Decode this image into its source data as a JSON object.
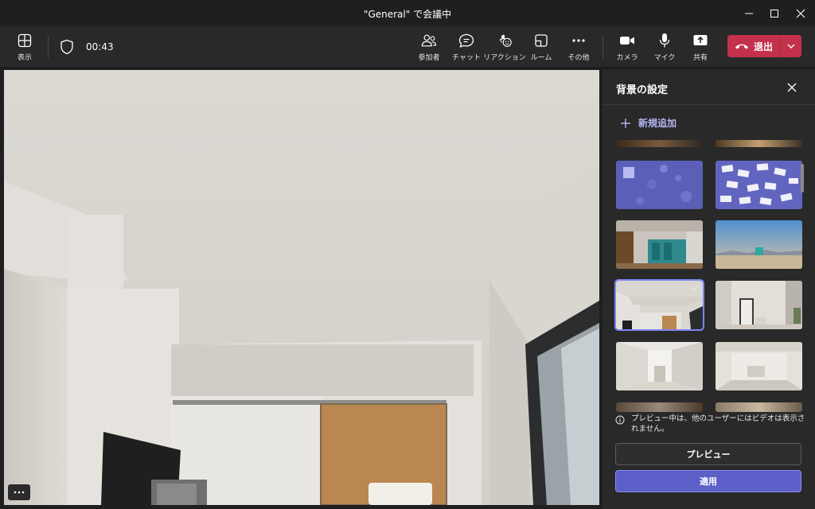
{
  "window": {
    "title": "\"General\" で会議中",
    "controls": [
      "minimize-icon",
      "maximize-icon",
      "close-icon"
    ]
  },
  "toolbar": {
    "view_label": "表示",
    "timer": "00:43",
    "participants_label": "参加者",
    "chat_label": "チャット",
    "reactions_label": "リアクション",
    "rooms_label": "ルーム",
    "more_label": "その他",
    "camera_label": "カメラ",
    "mic_label": "マイク",
    "share_label": "共有",
    "leave_label": "退出",
    "leave_color": "#c4314b"
  },
  "panel": {
    "title": "背景の設定",
    "add_new_label": "新規追加",
    "selected_index": 4,
    "note": "プレビュー中は、他のユーザーにはビデオは表示されません。",
    "preview_label": "プレビュー",
    "apply_label": "適用",
    "accent_color": "#5b5fc7"
  },
  "video": {
    "more_icon": "ellipsis-icon"
  }
}
